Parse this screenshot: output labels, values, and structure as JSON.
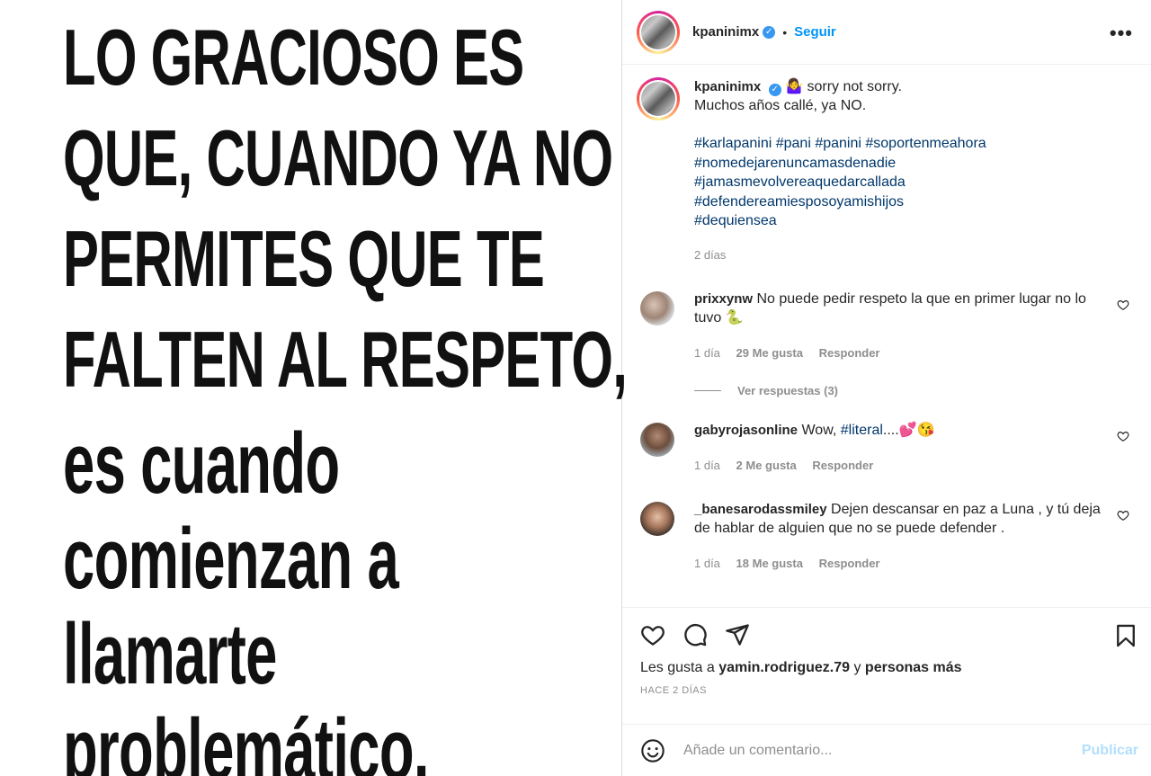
{
  "meme": {
    "lines": [
      "LO GRACIOSO ES",
      "QUE, CUANDO YA NO",
      "PERMITES QUE TE",
      "FALTEN AL RESPETO,",
      "es cuando",
      "comienzan a",
      "llamarte",
      "problemático."
    ]
  },
  "header": {
    "username": "kpaninimx",
    "separator": "•",
    "follow_label": "Seguir",
    "more_label": "•••"
  },
  "caption": {
    "username": "kpaninimx",
    "emoji": "🤷‍♀️",
    "line1": "sorry not sorry.",
    "line2": "Muchos años callé, ya NO.",
    "hashtags": [
      "#karlapanini #pani #panini #soportenmeahora",
      "#nomedejarenuncamasdenadie",
      "#jamasmevolvereaquedarcallada",
      "#defendereamiesposoyamishijos",
      "#dequiensea"
    ],
    "time": "2 días"
  },
  "comments": [
    {
      "username": "prixxynw",
      "text": "No puede pedir respeto la que en primer lugar no lo tuvo 🐍",
      "time": "1 día",
      "likes": "29 Me gusta",
      "reply": "Responder",
      "view_replies": "Ver respuestas (3)"
    },
    {
      "username": "gabyrojasonline",
      "text_before": "Wow, ",
      "tag": "#literal",
      "text_after": "....💕😘",
      "time": "1 día",
      "likes": "2 Me gusta",
      "reply": "Responder"
    },
    {
      "username": "_banesarodassmiley",
      "text": "Dejen descansar en paz a Luna , y tú deja de hablar de alguien que no se puede defender .",
      "time": "1 día",
      "likes": "18 Me gusta",
      "reply": "Responder"
    }
  ],
  "actions": {
    "likes_prefix": "Les gusta a",
    "liked_by": "yamin.rodriguez.79",
    "likes_and": "y",
    "likes_more": "personas más",
    "ago": "HACE 2 DÍAS"
  },
  "add_comment": {
    "placeholder": "Añade un comentario...",
    "publish_label": "Publicar"
  },
  "colors": {
    "link": "#00376b",
    "follow": "#0095f6",
    "muted": "#8e8e8e",
    "publish_disabled": "#b2dffc"
  }
}
